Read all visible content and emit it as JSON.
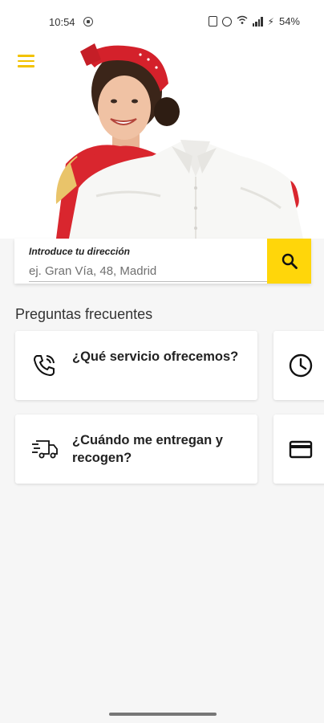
{
  "status_bar": {
    "time": "10:54",
    "battery": "54%",
    "icons": [
      "nfc-icon",
      "alarm-icon",
      "wifi-icon",
      "signal-icon",
      "charging-icon"
    ]
  },
  "header": {
    "menu_icon": "hamburger-menu-icon",
    "accent_color": "#f2c200"
  },
  "search": {
    "label": "Introduce tu dirección",
    "placeholder": "ej. Gran Vía, 48, Madrid",
    "value": "",
    "button_icon": "search-icon",
    "button_color": "#ffd60a"
  },
  "faq": {
    "title": "Preguntas frecuentes",
    "cards": [
      {
        "icon": "phone-call-icon",
        "label": "¿Qué servicio ofrecemos?"
      },
      {
        "icon": "clock-icon",
        "label": ""
      },
      {
        "icon": "delivery-truck-icon",
        "label": "¿Cuándo me entregan y recogen?"
      },
      {
        "icon": "credit-card-icon",
        "label": ""
      }
    ]
  }
}
